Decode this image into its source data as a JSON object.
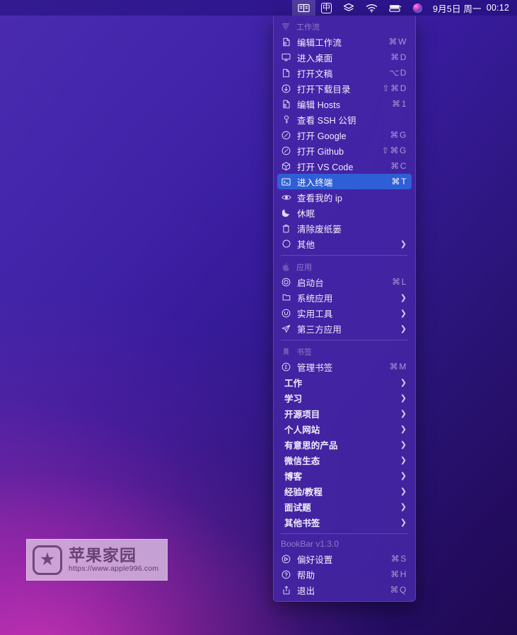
{
  "menubar": {
    "items": [
      {
        "name": "bookbar-icon",
        "glyph": "book",
        "active": true
      },
      {
        "name": "input-method-icon",
        "glyph": "ime",
        "label": "中",
        "active": false
      },
      {
        "name": "bartender-icon",
        "glyph": "layers",
        "active": false
      },
      {
        "name": "wifi-icon",
        "glyph": "wifi",
        "active": false
      },
      {
        "name": "battery-icon",
        "glyph": "battery",
        "active": false
      },
      {
        "name": "siri-icon",
        "glyph": "siri",
        "active": false
      }
    ],
    "date": "9月5日 周一",
    "time": "00:12"
  },
  "menu": {
    "sections": [
      {
        "header": {
          "label": "工作流",
          "icon": "workflow-icon"
        },
        "items": [
          {
            "label": "编辑工作流",
            "shortcut": "⌘W",
            "icon": "file-gear-icon"
          },
          {
            "label": "进入桌面",
            "shortcut": "⌘D",
            "icon": "display-icon"
          },
          {
            "label": "打开文稿",
            "shortcut": "⌥D",
            "icon": "document-icon"
          },
          {
            "label": "打开下载目录",
            "shortcut": "⇧⌘D",
            "icon": "download-icon"
          },
          {
            "label": "编辑 Hosts",
            "shortcut": "⌘1",
            "icon": "file-gear-icon"
          },
          {
            "label": "查看 SSH 公钥",
            "shortcut": "",
            "icon": "key-icon"
          },
          {
            "label": "打开 Google",
            "shortcut": "⌘G",
            "icon": "compass-icon"
          },
          {
            "label": "打开 Github",
            "shortcut": "⇧⌘G",
            "icon": "compass-icon"
          },
          {
            "label": "打开 VS Code",
            "shortcut": "⌘C",
            "icon": "cube-icon"
          },
          {
            "label": "进入终端",
            "shortcut": "⌘T",
            "icon": "terminal-icon",
            "selected": true
          },
          {
            "label": "查看我的 ip",
            "shortcut": "",
            "icon": "eye-icon"
          },
          {
            "label": "休眠",
            "shortcut": "",
            "icon": "moon-icon"
          },
          {
            "label": "清除废纸篓",
            "shortcut": "",
            "icon": "trash-icon"
          },
          {
            "label": "其他",
            "shortcut": "",
            "icon": "circle-icon",
            "submenu": true
          }
        ]
      },
      {
        "header": {
          "label": "应用",
          "icon": "apple-icon"
        },
        "items": [
          {
            "label": "启动台",
            "shortcut": "⌘L",
            "icon": "launchpad-icon"
          },
          {
            "label": "系统应用",
            "shortcut": "",
            "icon": "folder-icon",
            "submenu": true
          },
          {
            "label": "实用工具",
            "shortcut": "",
            "icon": "utility-icon",
            "submenu": true
          },
          {
            "label": "第三方应用",
            "shortcut": "",
            "icon": "send-icon",
            "submenu": true
          }
        ]
      },
      {
        "header": {
          "label": "书签",
          "icon": "bookmark-icon"
        },
        "items": [
          {
            "label": "管理书签",
            "shortcut": "⌘M",
            "icon": "edit-bookmark-icon"
          },
          {
            "label": "工作",
            "shortcut": "",
            "icon": "",
            "submenu": true
          },
          {
            "label": "学习",
            "shortcut": "",
            "icon": "",
            "submenu": true
          },
          {
            "label": "开源项目",
            "shortcut": "",
            "icon": "",
            "submenu": true
          },
          {
            "label": "个人网站",
            "shortcut": "",
            "icon": "",
            "submenu": true
          },
          {
            "label": "有意思的产品",
            "shortcut": "",
            "icon": "",
            "submenu": true
          },
          {
            "label": "微信生态",
            "shortcut": "",
            "icon": "",
            "submenu": true
          },
          {
            "label": "博客",
            "shortcut": "",
            "icon": "",
            "submenu": true
          },
          {
            "label": "经验/教程",
            "shortcut": "",
            "icon": "",
            "submenu": true
          },
          {
            "label": "面试题",
            "shortcut": "",
            "icon": "",
            "submenu": true
          },
          {
            "label": "其他书签",
            "shortcut": "",
            "icon": "",
            "submenu": true
          }
        ]
      },
      {
        "version": "BookBar v1.3.0",
        "items": [
          {
            "label": "偏好设置",
            "shortcut": "⌘S",
            "icon": "preferences-icon"
          },
          {
            "label": "帮助",
            "shortcut": "⌘H",
            "icon": "help-icon"
          },
          {
            "label": "退出",
            "shortcut": "⌘Q",
            "icon": "quit-icon"
          }
        ]
      }
    ]
  },
  "watermark": {
    "title": "苹果家园",
    "url": "https://www.apple996.com",
    "badge": "★"
  },
  "colors": {
    "menu_bg": "#4426a0",
    "highlight": "#2f5fd6",
    "text": "#f2eefc",
    "muted": "#9c8fcf"
  }
}
